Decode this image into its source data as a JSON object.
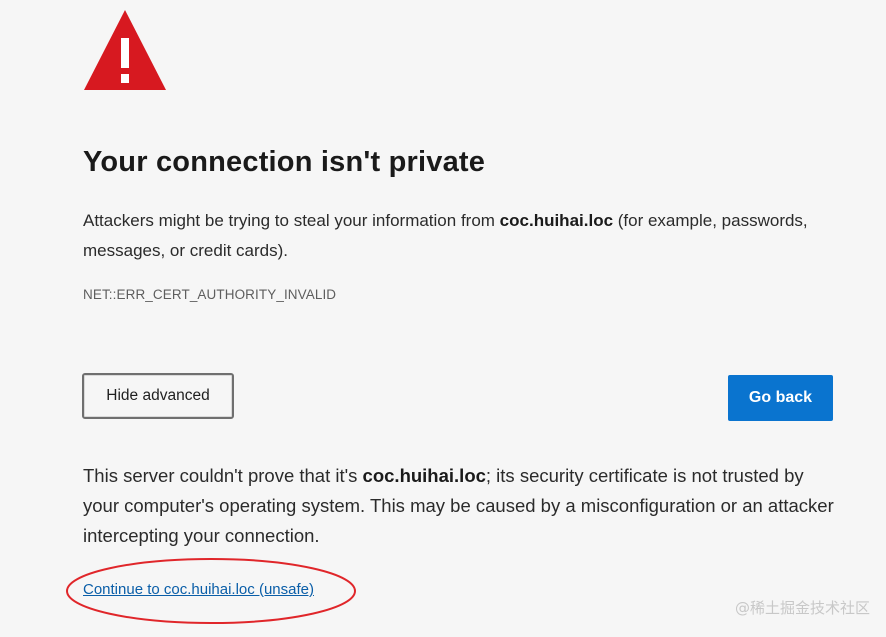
{
  "page": {
    "title": "Your connection isn't private",
    "intro": {
      "before": "Attackers might be trying to steal your information from ",
      "host": "coc.huihai.loc",
      "after": " (for example, passwords, messages, or credit cards)."
    },
    "error_code": "NET::ERR_CERT_AUTHORITY_INVALID",
    "buttons": {
      "hide_advanced": "Hide advanced",
      "go_back": "Go back"
    },
    "details": {
      "before": "This server couldn't prove that it's ",
      "host": "coc.huihai.loc",
      "after": "; its security certificate is not trusted by your computer's operating system. This may be caused by a misconfiguration or an attacker intercepting your connection."
    },
    "proceed_link": "Continue to coc.huihai.loc (unsafe)",
    "watermark": "@稀土掘金技术社区"
  },
  "icons": {
    "warning": "warning-triangle-icon"
  },
  "colors": {
    "warning_red": "#d71920",
    "primary_button": "#0a74cf",
    "link": "#0a5ea8",
    "annotation_circle": "#e0262a"
  }
}
